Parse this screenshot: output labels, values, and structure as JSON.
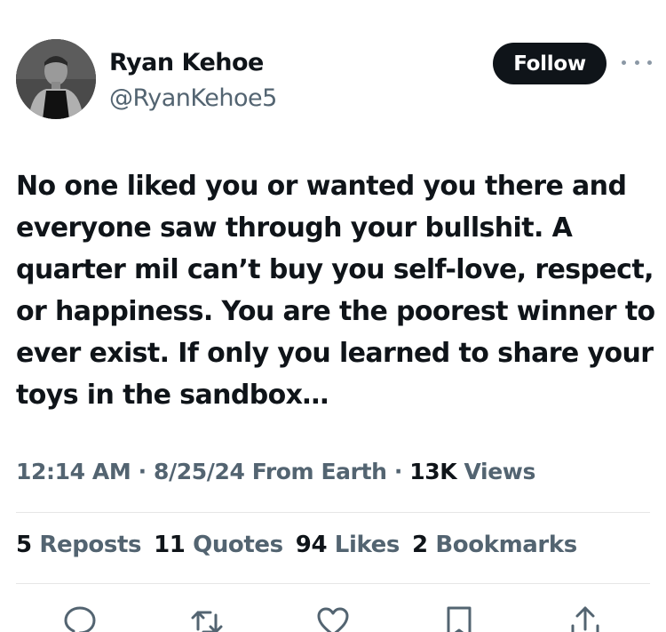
{
  "author": {
    "name": "Ryan Kehoe",
    "handle": "@RyanKehoe5"
  },
  "follow_label": "Follow",
  "tweet": {
    "text": "No one liked you or wanted you there and everyone saw through your bullshit. A quarter mil can’t buy you self-love, respect, or happiness. You are the poorest winner to ever exist. If only you learned to share your toys in the sandbox…"
  },
  "meta": {
    "time": "12:14 AM",
    "sep1": " · ",
    "date": "8/25/24",
    "source": " From Earth",
    "sep2": " · ",
    "views_count": "13K",
    "views_label": " Views"
  },
  "stats": {
    "reposts_count": "5",
    "reposts_label": "Reposts",
    "quotes_count": "11",
    "quotes_label": "Quotes",
    "likes_count": "94",
    "likes_label": "Likes",
    "bookmarks_count": "2",
    "bookmarks_label": "Bookmarks"
  },
  "icons": {
    "more": "more-horizontal-icon",
    "reply": "reply-icon",
    "repost": "repost-icon",
    "like": "heart-icon",
    "bookmark": "bookmark-icon",
    "share": "share-icon"
  },
  "colors": {
    "text_primary": "#0f1419",
    "text_secondary": "#536471",
    "follow_bg": "#0f1419"
  }
}
